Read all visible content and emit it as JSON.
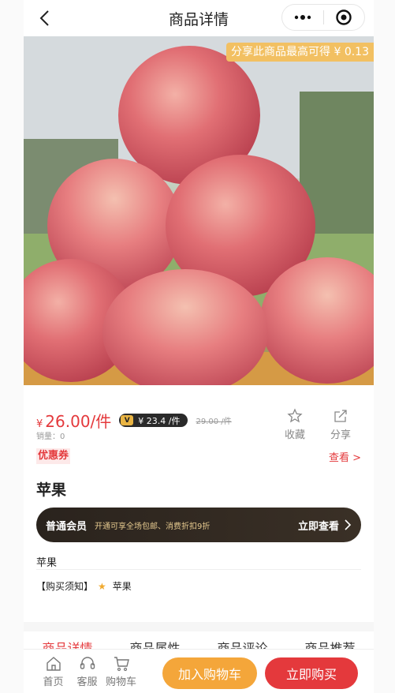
{
  "nav": {
    "title": "商品详情",
    "more_icon": "more-dots-icon",
    "target_icon": "target-circle-icon"
  },
  "hero": {
    "share_tip": "分享此商品最高可得 ¥ 0.13"
  },
  "price": {
    "currency": "¥",
    "amount": "26.00/件",
    "vip_badge": "V",
    "vip_price": "¥ 23.4 /件",
    "original": "29.00 /件",
    "sales": "销量：0"
  },
  "actions": {
    "favorite": "收藏",
    "share": "分享"
  },
  "coupon": {
    "label": "优惠券",
    "link": "查看 >"
  },
  "product": {
    "name": "苹果",
    "sub_name": "苹果"
  },
  "member": {
    "title": "普通会员",
    "desc": "开通可享全场包邮、消费折扣9折",
    "button": "立即查看"
  },
  "notice": {
    "label": "【购买须知】",
    "text": "苹果"
  },
  "tabs": [
    "商品详情",
    "商品属性",
    "商品评论",
    "商品推荐"
  ],
  "bottom": {
    "home": "首页",
    "service": "客服",
    "cart": "购物车",
    "add_cart": "加入购物车",
    "buy_now": "立即购买"
  },
  "colors": {
    "accent_red": "#e4393c",
    "accent_orange": "#f4a63a",
    "tip_yellow": "#f2c062"
  }
}
